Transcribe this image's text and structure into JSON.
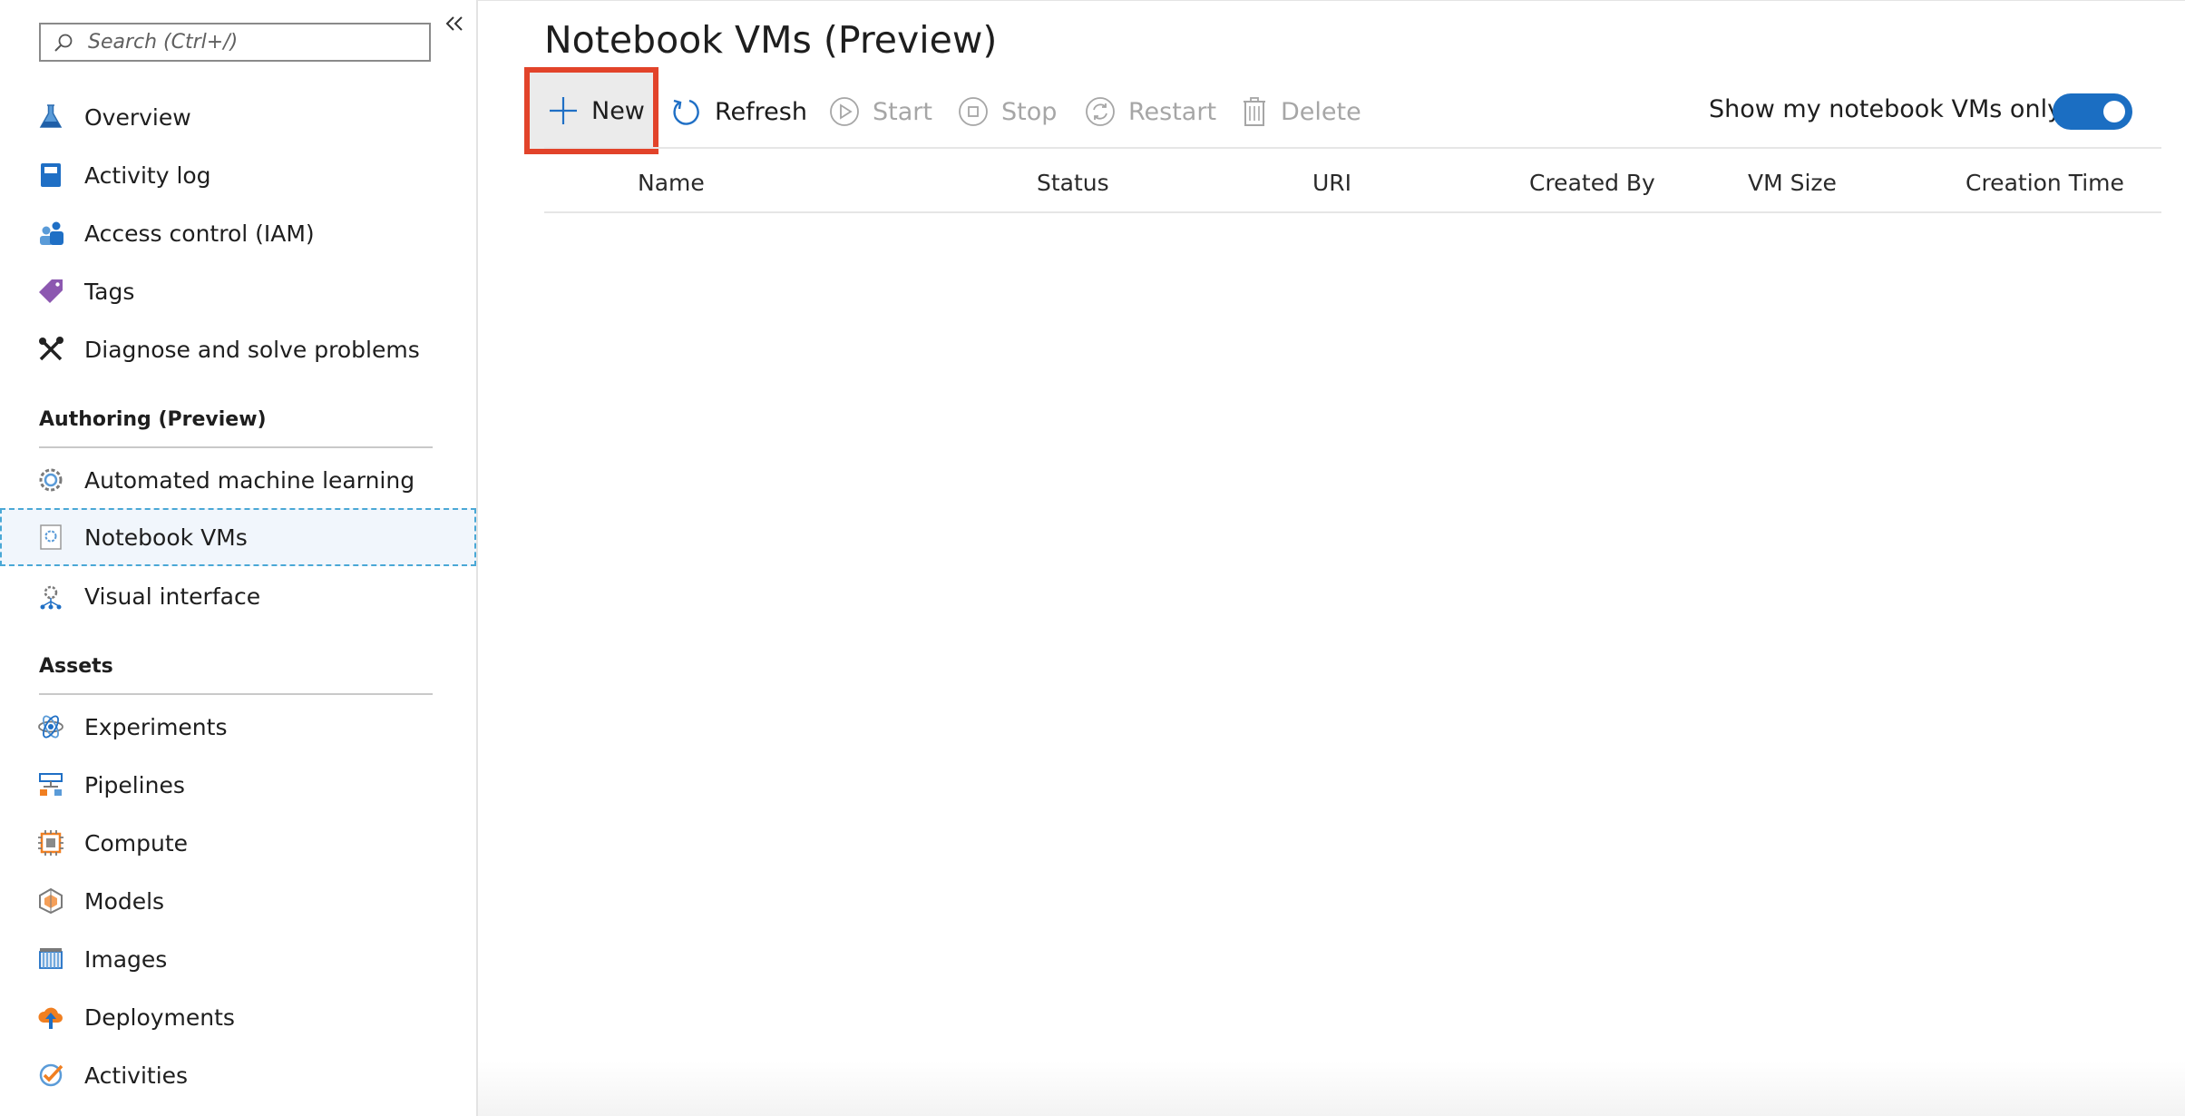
{
  "sidebar": {
    "search": {
      "placeholder": "Search (Ctrl+/)"
    },
    "top_items": [
      {
        "label": "Overview",
        "icon": "flask-icon"
      },
      {
        "label": "Activity log",
        "icon": "book-icon"
      },
      {
        "label": "Access control (IAM)",
        "icon": "people-icon"
      },
      {
        "label": "Tags",
        "icon": "tag-icon"
      },
      {
        "label": "Diagnose and solve problems",
        "icon": "wrench-icon"
      }
    ],
    "sections": [
      {
        "title": "Authoring (Preview)",
        "items": [
          {
            "label": "Automated machine learning",
            "icon": "gear-icon"
          },
          {
            "label": "Notebook VMs",
            "icon": "notebook-icon",
            "selected": true
          },
          {
            "label": "Visual interface",
            "icon": "network-icon"
          }
        ]
      },
      {
        "title": "Assets",
        "items": [
          {
            "label": "Experiments",
            "icon": "atom-icon"
          },
          {
            "label": "Pipelines",
            "icon": "pipeline-icon"
          },
          {
            "label": "Compute",
            "icon": "chip-icon"
          },
          {
            "label": "Models",
            "icon": "model-icon"
          },
          {
            "label": "Images",
            "icon": "images-icon"
          },
          {
            "label": "Deployments",
            "icon": "cloud-upload-icon"
          },
          {
            "label": "Activities",
            "icon": "check-circle-icon"
          }
        ]
      }
    ]
  },
  "main": {
    "title": "Notebook VMs (Preview)",
    "toolbar": {
      "new": "New",
      "refresh": "Refresh",
      "start": "Start",
      "stop": "Stop",
      "restart": "Restart",
      "delete": "Delete"
    },
    "toggle": {
      "label": "Show my notebook VMs only",
      "on": true
    },
    "table": {
      "columns": [
        "Name",
        "Status",
        "URI",
        "Created By",
        "VM Size",
        "Creation Time"
      ],
      "rows": []
    }
  },
  "colors": {
    "accent": "#1b6ec2",
    "highlight_border": "#e2432a",
    "selected_bg": "#f1f6fc",
    "selected_border": "#4aa8d6"
  }
}
